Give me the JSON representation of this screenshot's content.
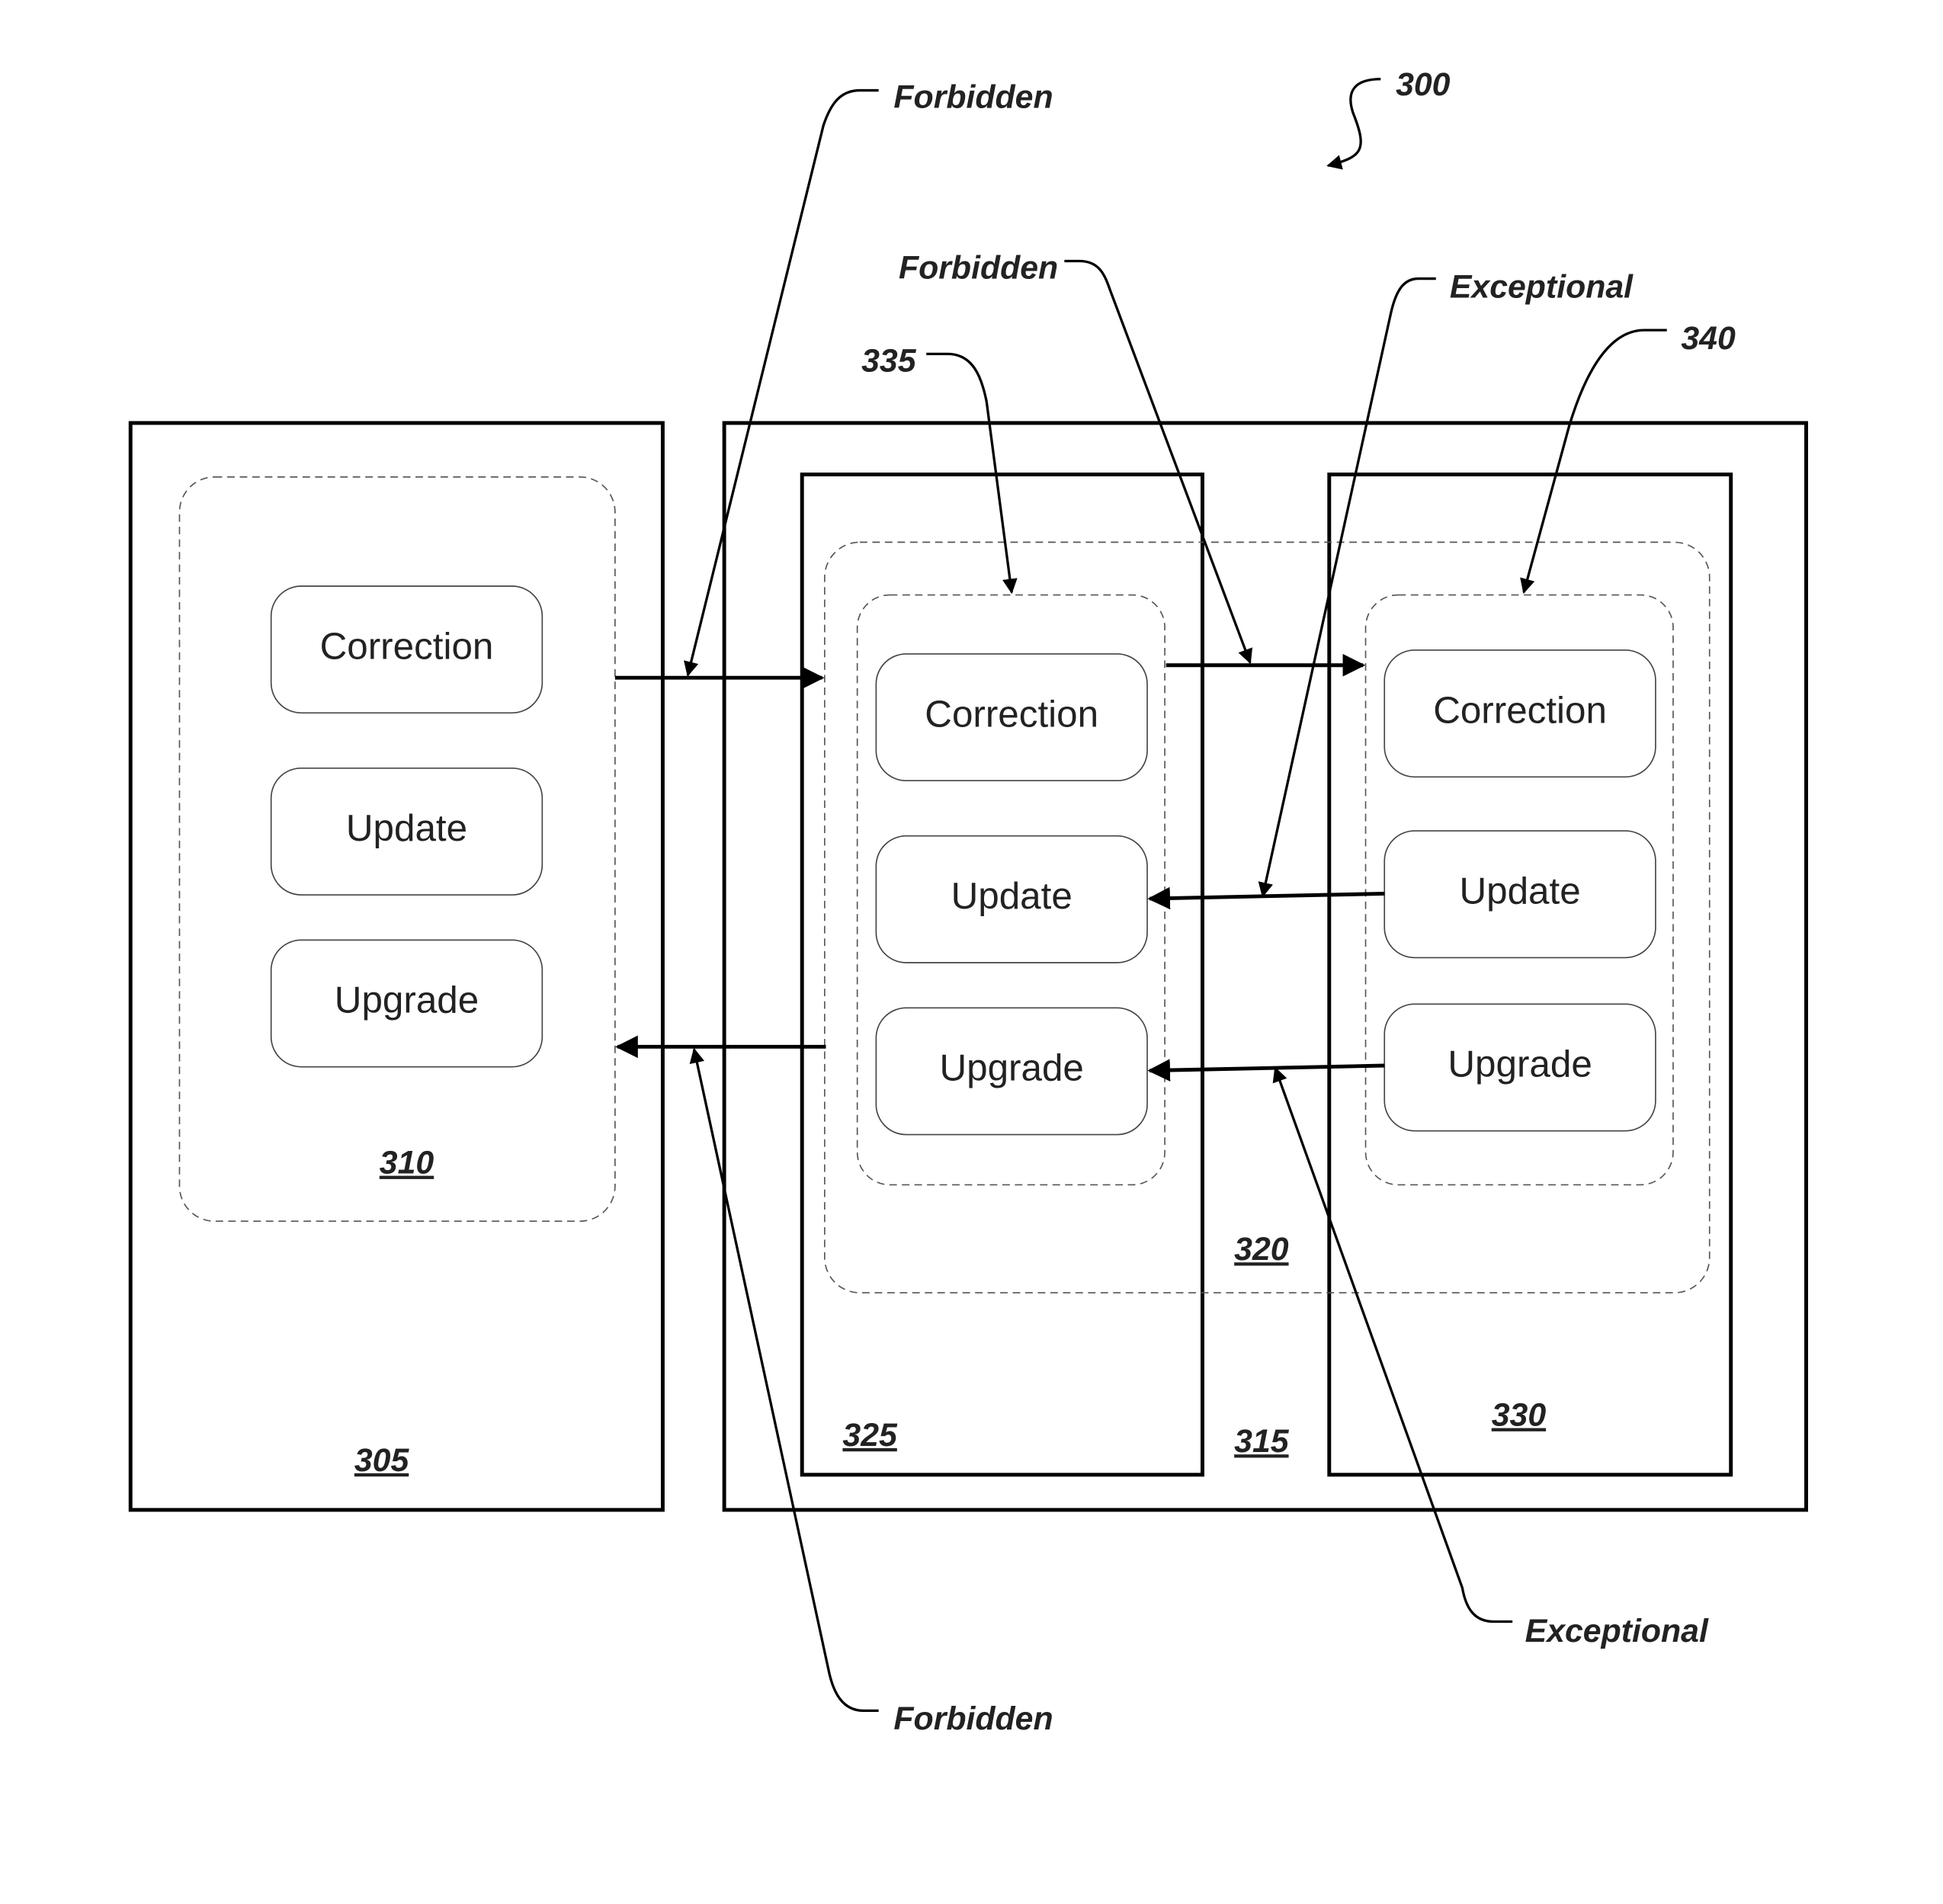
{
  "figure": {
    "ref": "300",
    "containers": {
      "c305": {
        "ref": "305"
      },
      "c310": {
        "ref": "310"
      },
      "c315": {
        "ref": "315"
      },
      "c320": {
        "ref": "320"
      },
      "c325": {
        "ref": "325"
      },
      "c330": {
        "ref": "330"
      },
      "c335": {
        "ref": "335"
      },
      "c340": {
        "ref": "340"
      }
    },
    "nodes": {
      "left": [
        "Correction",
        "Update",
        "Upgrade"
      ],
      "middle": [
        "Correction",
        "Update",
        "Upgrade"
      ],
      "right": [
        "Correction",
        "Update",
        "Upgrade"
      ]
    },
    "callouts": {
      "forbidden_top": "Forbidden",
      "forbidden_mid": "Forbidden",
      "exceptional_top": "Exceptional",
      "exceptional_bottom": "Exceptional",
      "forbidden_bottom": "Forbidden"
    }
  }
}
